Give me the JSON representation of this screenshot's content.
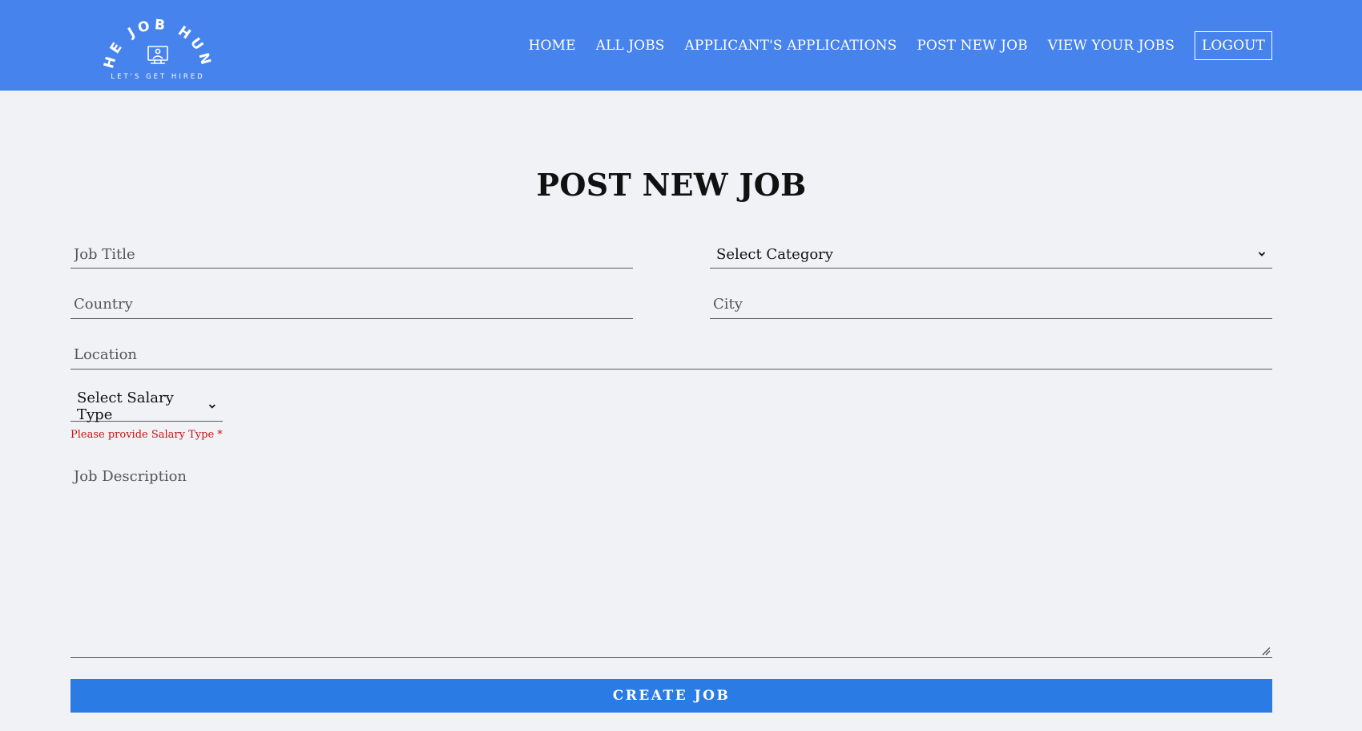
{
  "brand": {
    "logo_top_text": "THE JOB HUNT",
    "logo_tagline": "LET'S GET HIRED"
  },
  "nav": {
    "home": "HOME",
    "all_jobs": "ALL JOBS",
    "applicants_applications": "APPLICANT'S APPLICATIONS",
    "post_new_job": "POST NEW JOB",
    "view_your_jobs": "VIEW YOUR JOBS",
    "logout": "LOGOUT"
  },
  "page": {
    "title": "POST NEW JOB"
  },
  "form": {
    "job_title_placeholder": "Job Title",
    "category_selected": "Select Category",
    "country_placeholder": "Country",
    "city_placeholder": "City",
    "location_placeholder": "Location",
    "salary_type_selected": "Select Salary Type",
    "salary_type_error": "Please provide Salary Type *",
    "description_placeholder": "Job Description",
    "submit_label": "CREATE JOB"
  },
  "colors": {
    "header_bg": "#4683ec",
    "page_bg": "#f0f2f6",
    "submit_bg": "#2a7be4",
    "error": "#cc1111"
  }
}
